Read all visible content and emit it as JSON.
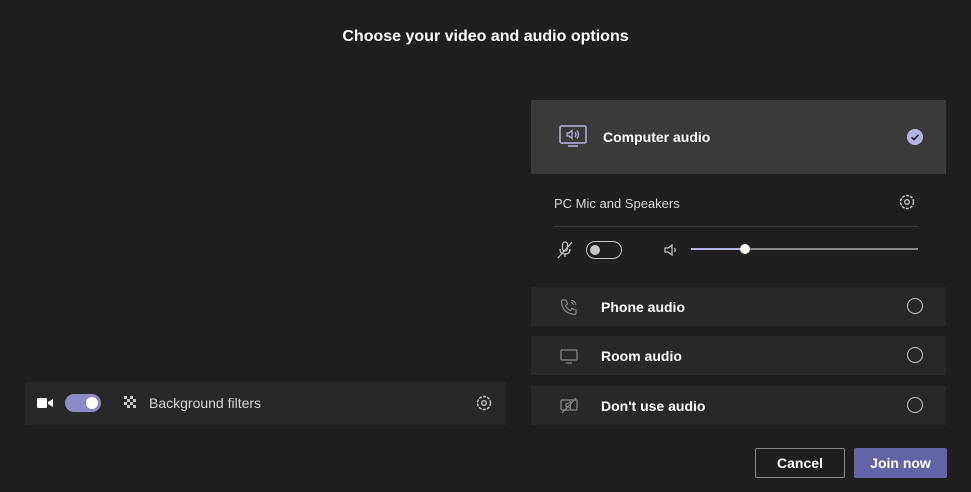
{
  "title": "Choose your video and audio options",
  "video": {
    "camera_on": true,
    "background_filters_label": "Background filters",
    "icons": {
      "camera": "video-camera-icon",
      "background": "background-filter-icon",
      "settings": "gear-icon"
    }
  },
  "audio": {
    "options": [
      {
        "id": "computer",
        "label": "Computer audio",
        "selected": true,
        "icon": "computer-speaker-icon"
      },
      {
        "id": "phone",
        "label": "Phone audio",
        "selected": false,
        "icon": "phone-icon"
      },
      {
        "id": "room",
        "label": "Room audio",
        "selected": false,
        "icon": "monitor-icon"
      },
      {
        "id": "none",
        "label": "Don't use audio",
        "selected": false,
        "icon": "speaker-off-icon"
      }
    ],
    "device": {
      "label": "PC Mic and Speakers",
      "mic_on": false,
      "volume_fraction": 0.24
    }
  },
  "buttons": {
    "cancel": "Cancel",
    "join": "Join now"
  },
  "colors": {
    "background": "#201f1f",
    "panel": "#292828",
    "selected": "#3b3a39",
    "accent": "#6264a7",
    "accent_light": "#b3b4e6"
  }
}
